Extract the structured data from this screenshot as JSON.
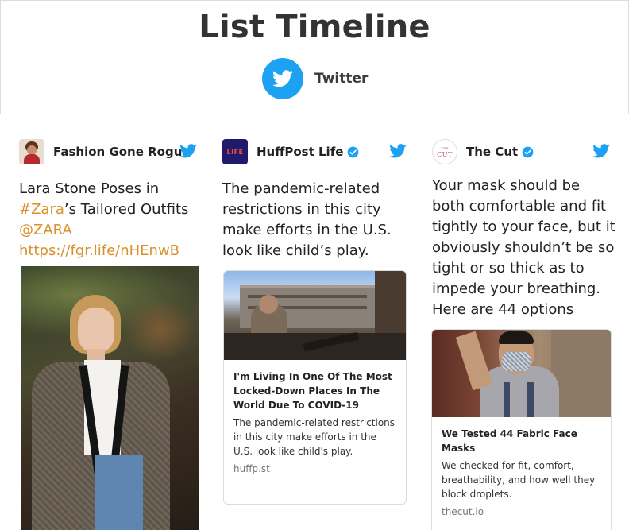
{
  "header": {
    "title": "List Timeline",
    "source_label": "Twitter"
  },
  "tweets": [
    {
      "author": "Fashion Gone Rogue",
      "text": "Lara Stone Poses in ",
      "hashtag": "#Zara",
      "text_after": "’s Tailored Outfits",
      "mention": "@ZARA",
      "url": "https://fgr.life/nHEnwB"
    },
    {
      "author": "HuffPost Life",
      "avatar_text": "LIFE",
      "text": "The pandemic-related restrictions in this city make efforts in the U.S. look like child’s play.",
      "card": {
        "title": "I'm Living In One Of The Most Locked-Down Places In The World Due To COVID-19",
        "description": "The pandemic-related restrictions in this city make efforts in the U.S. look like child's play.",
        "domain": "huffp.st"
      }
    },
    {
      "author": "The Cut",
      "avatar_text": "CUT",
      "avatar_text_small": "THE",
      "text": "Your mask should be both comfortable and fit tightly to your face, but it obviously shouldn’t be so tight or so thick as to impede your breathing. Here are 44 options",
      "card": {
        "title": "We Tested 44 Fabric Face Masks",
        "description": "We checked for fit, comfort, breathability, and how well they block droplets.",
        "domain": "thecut.io"
      }
    }
  ],
  "colors": {
    "twitter_blue": "#1da1f2",
    "link": "#d9902a",
    "huffpost_avatar": "#1f1a6b",
    "cut_avatar": "#c4566b"
  },
  "icons": {
    "brand": "twitter-bird-icon",
    "verified": "verified-badge-icon"
  }
}
